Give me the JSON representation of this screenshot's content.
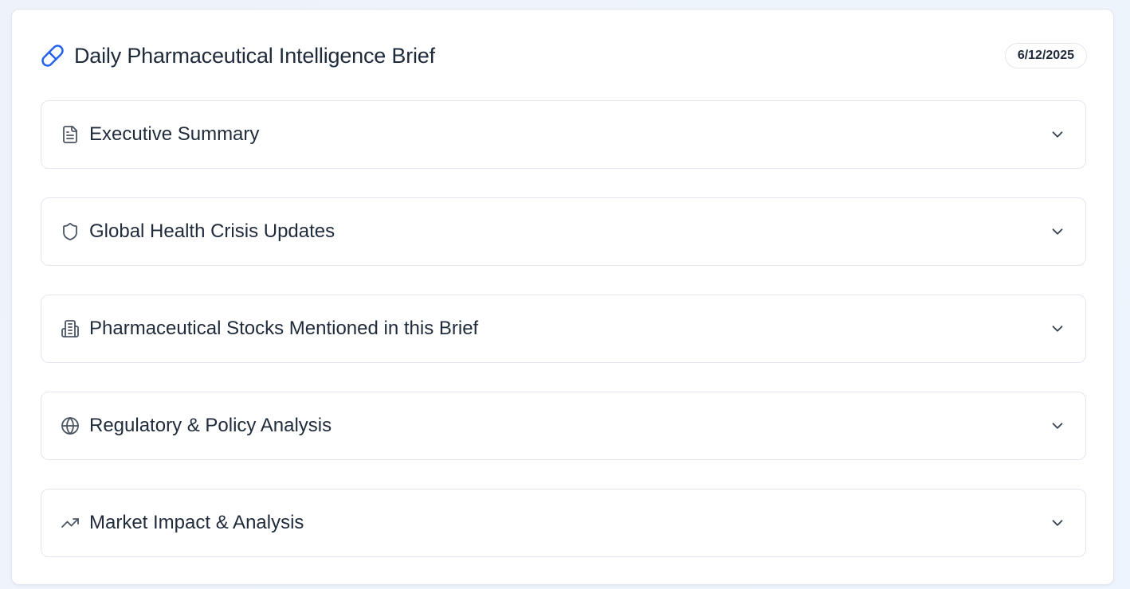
{
  "header": {
    "title": "Daily Pharmaceutical Intelligence Brief",
    "title_icon": "pill-icon",
    "date": "6/12/2025"
  },
  "sections": [
    {
      "label": "Executive Summary",
      "icon": "file-text-icon"
    },
    {
      "label": "Global Health Crisis Updates",
      "icon": "shield-icon"
    },
    {
      "label": "Pharmaceutical Stocks Mentioned in this Brief",
      "icon": "building-icon"
    },
    {
      "label": "Regulatory & Policy Analysis",
      "icon": "globe-icon"
    },
    {
      "label": "Market Impact & Analysis",
      "icon": "trending-up-icon"
    }
  ],
  "colors": {
    "accent": "#2563eb",
    "text": "#1f2a3a",
    "border": "#e2e6ee",
    "icon": "#4b5563"
  }
}
